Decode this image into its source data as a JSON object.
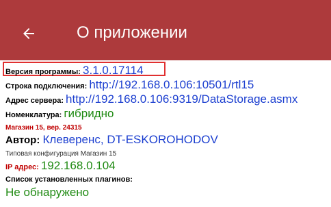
{
  "header": {
    "title": "О приложении",
    "back_icon": "arrow-left-icon"
  },
  "info": {
    "version_label": "Версия программы: ",
    "version_value": "3.1.0.17114",
    "connection_label": "Строка подключения: ",
    "connection_value": "http://192.168.0.106:10501/rtl15",
    "server_label": "Адрес сервера: ",
    "server_value": "http://192.168.0.106:9319/DataStorage.asmx",
    "nomenclature_label": "Номенклатура: ",
    "nomenclature_value": "гибридно",
    "store_version": "Магазин 15, вер. 24315",
    "author_label": "Автор: ",
    "author_value": "Клеверенс, DT-ESKOROHODOV",
    "config_text": "Типовая конфигурация Магазин 15",
    "ip_label": "IP адрес: ",
    "ip_value": "192.168.0.104",
    "plugins_label": "Список установленных плагинов:",
    "plugins_value": "Не обнаружено"
  },
  "colors": {
    "appbar": "#ad3a3c",
    "link_blue": "#1c3fd0",
    "green": "#1f8a12",
    "red": "#c00000",
    "highlight_border": "#e03030"
  }
}
